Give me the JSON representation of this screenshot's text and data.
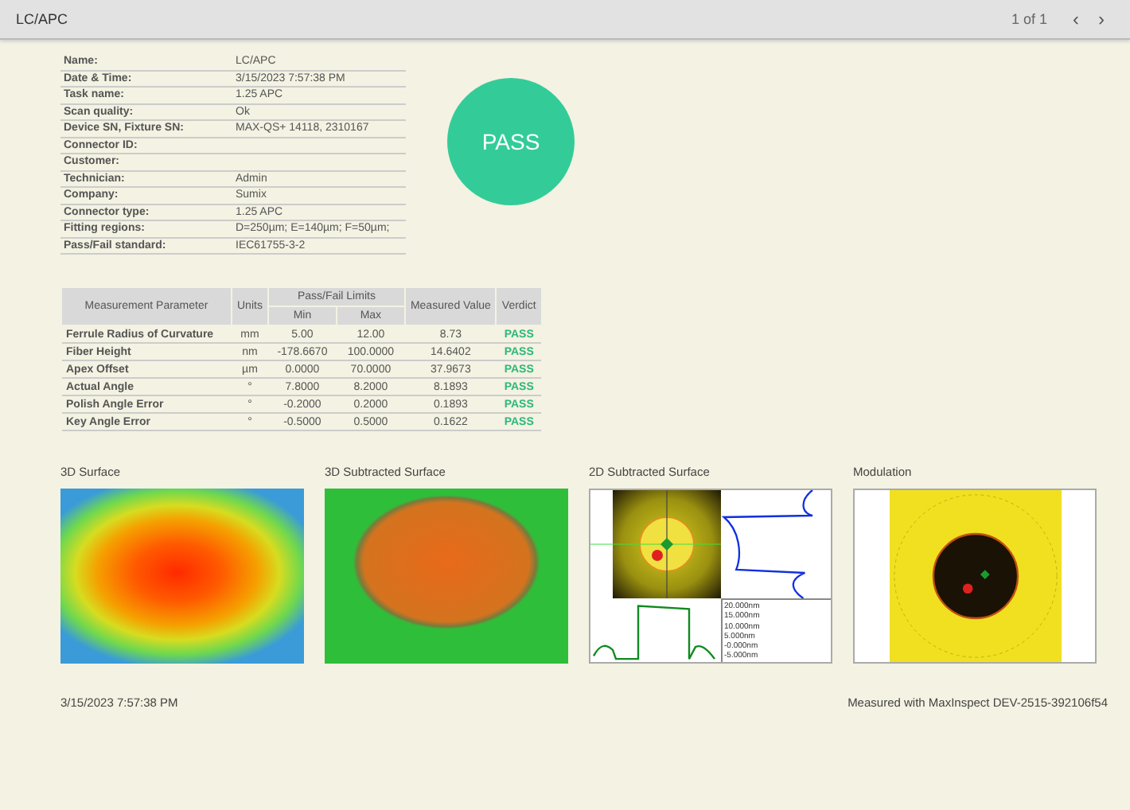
{
  "header": {
    "title": "LC/APC",
    "page": "1 of 1",
    "prev": "‹",
    "next": "›"
  },
  "info": [
    {
      "label": "Name:",
      "value": "LC/APC"
    },
    {
      "label": "Date & Time:",
      "value": "3/15/2023 7:57:38 PM"
    },
    {
      "label": "Task name:",
      "value": "1.25 APC"
    },
    {
      "label": "Scan quality:",
      "value": "Ok"
    },
    {
      "label": "Device SN, Fixture SN:",
      "value": "MAX-QS+ 14118, 2310167"
    },
    {
      "label": "Connector ID:"
    },
    {
      "label": "Customer:"
    },
    {
      "label": "Technician:",
      "value": "Admin"
    },
    {
      "label": "Company:",
      "value": "Sumix"
    },
    {
      "label": "Connector type:",
      "value": "1.25 APC"
    },
    {
      "label": "Fitting regions:",
      "value": "D=250µm; E=140µm; F=50µm;"
    },
    {
      "label": "Pass/Fail standard:",
      "value": "IEC61755-3-2"
    }
  ],
  "overall_verdict": "PASS",
  "measurements": {
    "columns": {
      "parameter": "Measurement Parameter",
      "units": "Units",
      "limits": "Pass/Fail Limits",
      "min": "Min",
      "max": "Max",
      "measured": "Measured Value",
      "verdict": "Verdict"
    },
    "rows": [
      {
        "parameter": "Ferrule Radius of Curvature",
        "units": "mm",
        "min": "5.00",
        "max": "12.00",
        "measured": "8.73",
        "verdict": "PASS"
      },
      {
        "parameter": "Fiber Height",
        "units": "nm",
        "min": "-178.6670",
        "max": "100.0000",
        "measured": "14.6402",
        "verdict": "PASS"
      },
      {
        "parameter": "Apex Offset",
        "units": "µm",
        "min": "0.0000",
        "max": "70.0000",
        "measured": "37.9673",
        "verdict": "PASS"
      },
      {
        "parameter": "Actual Angle",
        "units": "°",
        "min": "7.8000",
        "max": "8.2000",
        "measured": "8.1893",
        "verdict": "PASS"
      },
      {
        "parameter": "Polish Angle Error",
        "units": "°",
        "min": "-0.2000",
        "max": "0.2000",
        "measured": "0.1893",
        "verdict": "PASS"
      },
      {
        "parameter": "Key Angle Error",
        "units": "°",
        "min": "-0.5000",
        "max": "0.5000",
        "measured": "0.1622",
        "verdict": "PASS"
      }
    ]
  },
  "panels": [
    {
      "title": "3D Surface",
      "kind": "surface3d"
    },
    {
      "title": "3D Subtracted Surface",
      "kind": "subtracted3d"
    },
    {
      "title": "2D Subtracted Surface",
      "kind": "subtracted2d",
      "axis_labels": [
        "20.000nm",
        "15.000nm",
        "10.000nm",
        "5.000nm",
        "-0.000nm",
        "-5.000nm"
      ]
    },
    {
      "title": "Modulation",
      "kind": "modulation"
    }
  ],
  "footer": {
    "timestamp": "3/15/2023 7:57:38 PM",
    "measured_with": "Measured with MaxInspect DEV-2515-392106f54"
  }
}
